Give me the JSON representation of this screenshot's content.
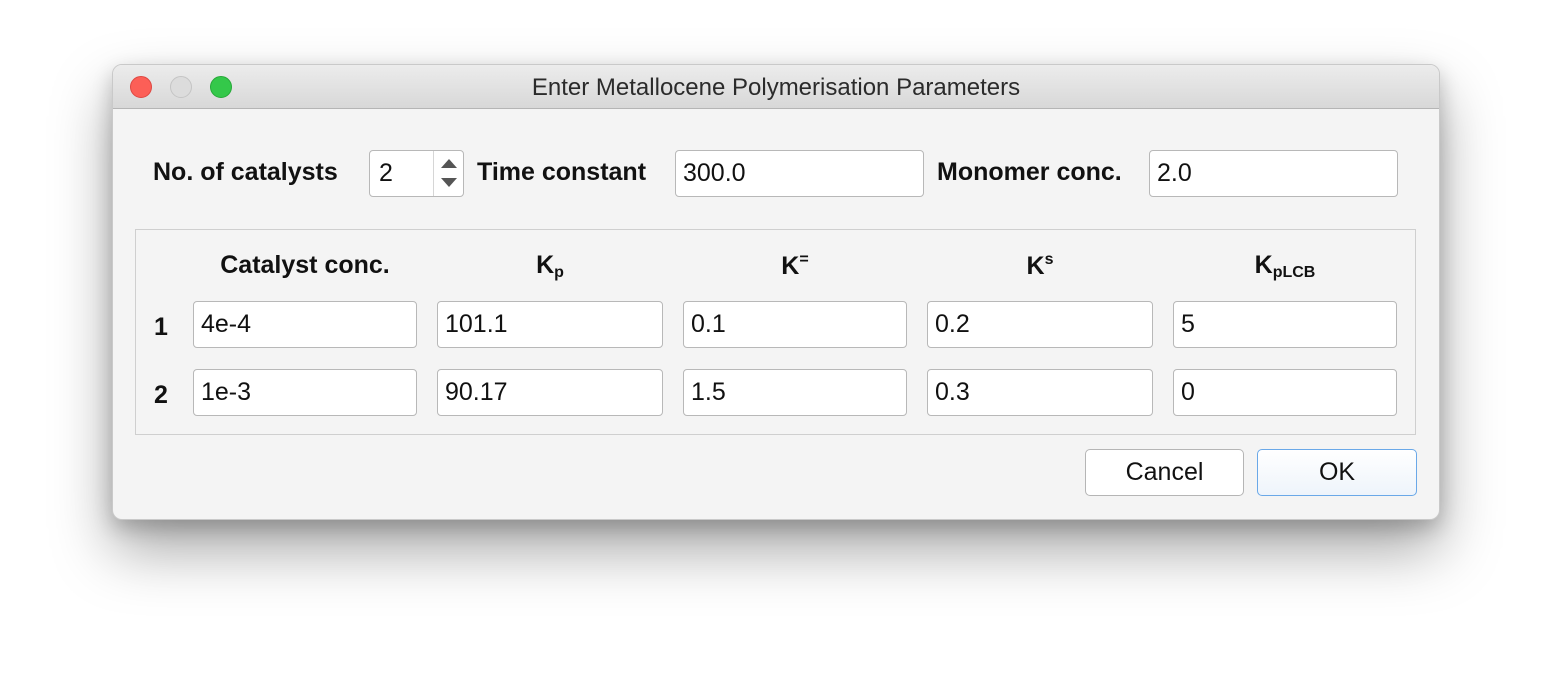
{
  "window": {
    "title": "Enter Metallocene Polymerisation Parameters"
  },
  "top_row": {
    "catalysts_label": "No. of catalysts",
    "catalysts_value": "2",
    "time_constant_label": "Time constant",
    "time_constant_value": "300.0",
    "monomer_label": "Monomer conc.",
    "monomer_value": "2.0"
  },
  "table": {
    "headers": {
      "catalyst_conc": "Catalyst conc.",
      "kp_base": "K",
      "kp_sub": "p",
      "keq_base": "K",
      "keq_sup": "=",
      "ks_base": "K",
      "ks_sup": "s",
      "kplcb_base": "K",
      "kplcb_sub": "pLCB"
    },
    "rows": [
      {
        "label": "1",
        "values": [
          "4e-4",
          "101.1",
          "0.1",
          "0.2",
          "5"
        ]
      },
      {
        "label": "2",
        "values": [
          "1e-3",
          "90.17",
          "1.5",
          "0.3",
          "0"
        ]
      }
    ]
  },
  "buttons": {
    "cancel": "Cancel",
    "ok": "OK"
  },
  "colors": {
    "close": "#fc5f57",
    "minimize_inactive": "#dcdcdc",
    "maximize": "#34c84a",
    "default_button_border": "#6aa8e8"
  }
}
